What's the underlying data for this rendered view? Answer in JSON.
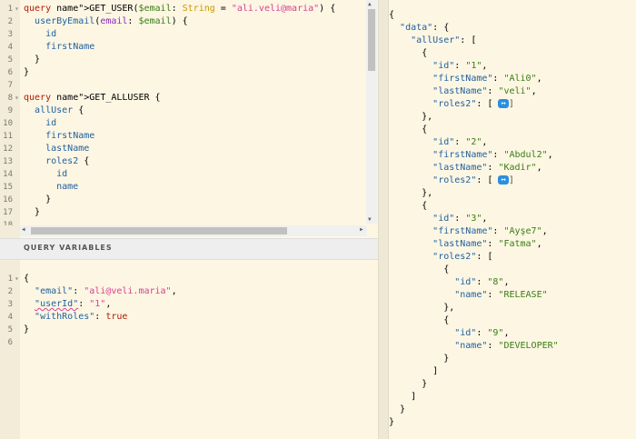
{
  "query_editor": {
    "lines": [
      "query GET_USER($email: String = \"ali.veli@maria\") {",
      "  userByEmail(email: $email) {",
      "    id",
      "    firstName",
      "  }",
      "}",
      "",
      "query GET_ALLUSER {",
      "  allUser {",
      "    id",
      "    firstName",
      "    lastName",
      "    roles2 {",
      "      id",
      "      name",
      "    }",
      "  }",
      ""
    ]
  },
  "query_variables": {
    "title": "QUERY VARIABLES",
    "lines": [
      "{",
      "  \"email\": \"ali@veli.maria\",",
      "  \"userId\": \"1\",",
      "  \"withRoles\": true",
      "}",
      ""
    ]
  },
  "result": {
    "lines": [
      "{",
      "  \"data\": {",
      "    \"allUser\": [",
      "      {",
      "        \"id\": \"1\",",
      "        \"firstName\": \"Ali0\",",
      "        \"lastName\": \"veli\",",
      "        \"roles2\": [",
      "      },",
      "      {",
      "        \"id\": \"2\",",
      "        \"firstName\": \"Abdul2\",",
      "        \"lastName\": \"Kadir\",",
      "        \"roles2\": [",
      "      },",
      "      {",
      "        \"id\": \"3\",",
      "        \"firstName\": \"Ayşe7\",",
      "        \"lastName\": \"Fatma\",",
      "        \"roles2\": [",
      "          {",
      "            \"id\": \"8\",",
      "            \"name\": \"RELEASE\"",
      "          },",
      "          {",
      "            \"id\": \"9\",",
      "            \"name\": \"DEVELOPER\"",
      "          }",
      "        ]",
      "      }",
      "    ]",
      "  }",
      "}"
    ],
    "collapsed_badge": "↔"
  }
}
